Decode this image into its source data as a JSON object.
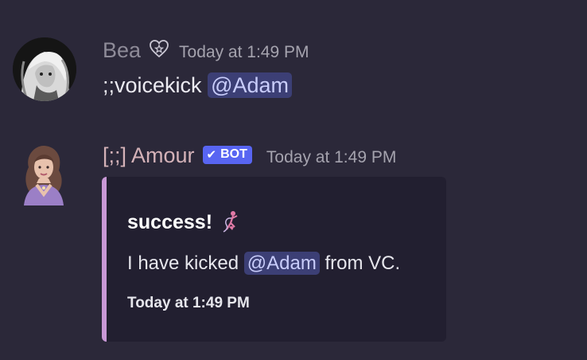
{
  "messages": [
    {
      "author": "Bea",
      "author_color": "#8e8b98",
      "badge_icon": "heart-star-icon",
      "timestamp": "Today at 1:49 PM",
      "content_prefix": ";;voicekick",
      "mention": "@Adam"
    },
    {
      "author": "[;;] Amour",
      "author_color": "#d4b2b8",
      "bot_tag": "BOT",
      "bot_tag_icon": "checkmark-icon",
      "timestamp": "Today at 1:49 PM",
      "embed": {
        "accent_color": "#c998d6",
        "title": "success!",
        "title_icon": "ribbon-dancer-icon",
        "description_prefix": "I have kicked",
        "description_mention": "@Adam",
        "description_suffix": "from VC.",
        "footer": "Today at 1:49 PM"
      }
    }
  ]
}
